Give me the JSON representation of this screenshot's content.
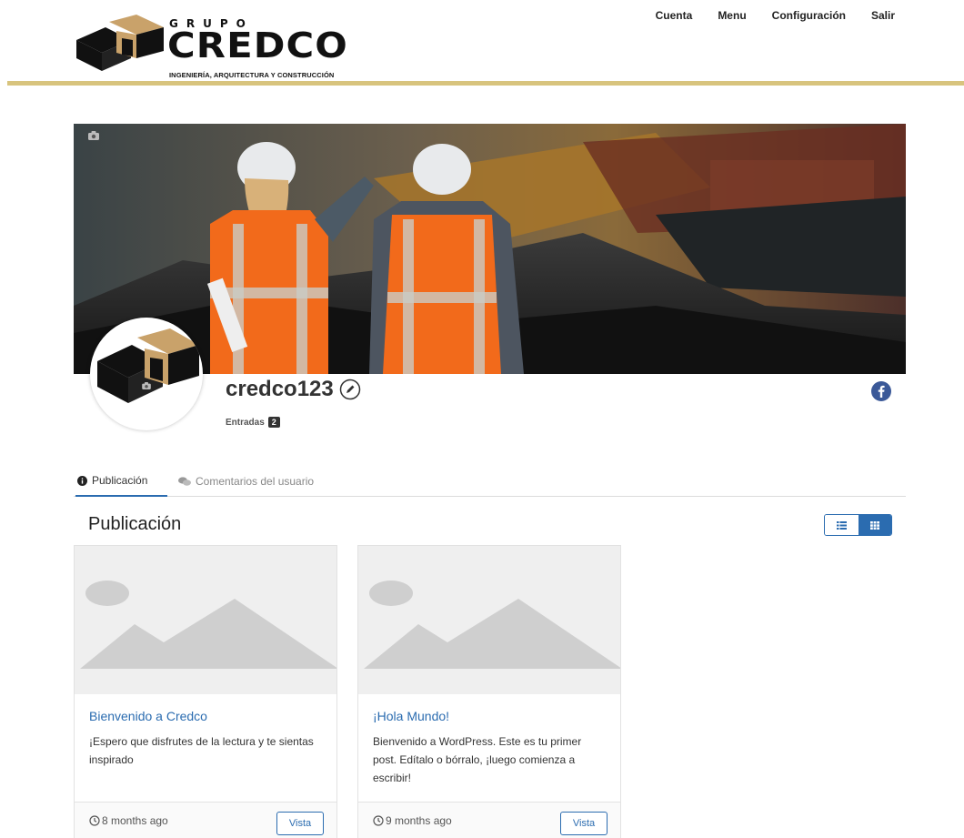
{
  "brand": {
    "top": "GRUPO",
    "main": "CREDCO",
    "sub": "INGENIERÍA, ARQUITECTURA Y CONSTRUCCIÓN"
  },
  "nav": {
    "items": [
      "Cuenta",
      "Menu",
      "Configuración",
      "Salir"
    ]
  },
  "profile": {
    "username": "credco123",
    "entries_label": "Entradas",
    "entries_count": "2"
  },
  "tabs": {
    "active": "Publicación",
    "inactive": "Comentarios del usuario"
  },
  "section": {
    "title": "Publicación"
  },
  "posts": [
    {
      "title": "Bienvenido a Credco",
      "excerpt": "¡Espero que disfrutes de la lectura y te sientas inspirado",
      "time": "8 months ago",
      "button": "Vista"
    },
    {
      "title": "¡Hola Mundo!",
      "excerpt": "Bienvenido a WordPress. Este es tu primer post. Edítalo o bórralo, ¡luego comienza a escribir!",
      "time": "9 months ago",
      "button": "Vista"
    }
  ],
  "colors": {
    "accent": "#2b6cb0",
    "brand_gold": "#c9a26a",
    "header_line": "#d8c47e",
    "vest_orange": "#f26a1b"
  }
}
